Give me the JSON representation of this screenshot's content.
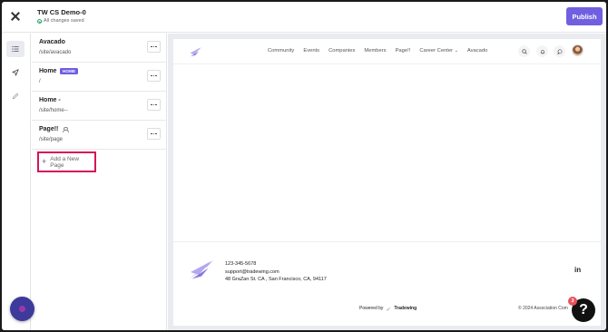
{
  "topbar": {
    "title": "TW CS Demo-0",
    "status": "All changes saved",
    "publish_label": "Publish"
  },
  "rail": {
    "items": [
      {
        "name": "pages-list-icon",
        "active": true
      },
      {
        "name": "navigation-icon",
        "active": false
      },
      {
        "name": "pencil-icon",
        "active": false
      }
    ]
  },
  "pages": {
    "items": [
      {
        "name": "Avacado",
        "path": "/site/avacado",
        "badge": ""
      },
      {
        "name": "Home",
        "path": "/",
        "badge": "HOME"
      },
      {
        "name": "Home -",
        "path": "/site/home--",
        "badge": ""
      },
      {
        "name": "Page!!",
        "path": "/site/page",
        "badge": ""
      }
    ],
    "add_label": "Add a New Page"
  },
  "site": {
    "nav": [
      "Community",
      "Events",
      "Companies",
      "Members",
      "Page!!",
      "Career Center",
      "Avacado"
    ],
    "footer": {
      "phone": "123-345-5678",
      "email": "support@tradewing.com",
      "address": "48 GraZan St. CA , San Francisco, CA, 94117",
      "powered_prefix": "Powered by",
      "powered_brand": "Tradewing",
      "copyright": "© 2024 Association Com",
      "social": "in"
    }
  },
  "help": {
    "label": "?",
    "badge_count": "3"
  },
  "colors": {
    "accent": "#7060e0",
    "highlight_border": "#d4145a",
    "logo": "#9d8fe6"
  }
}
